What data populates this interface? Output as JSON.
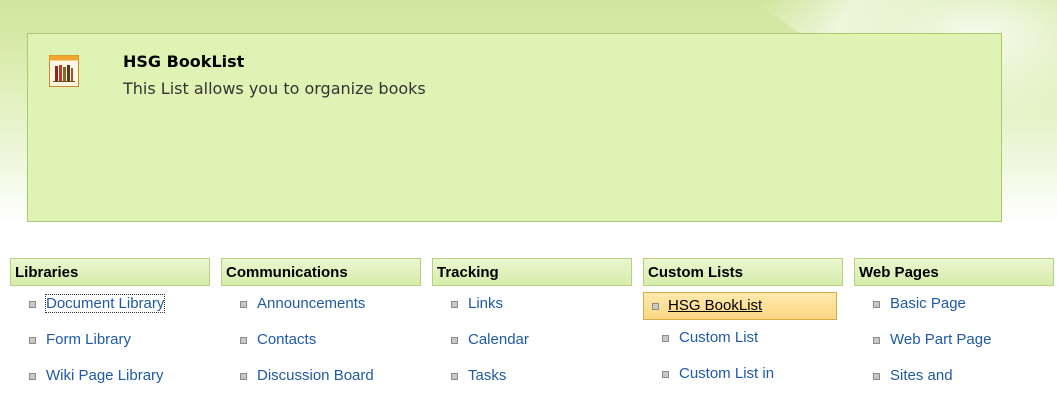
{
  "description": {
    "title": "HSG BookList",
    "text": "This List allows you to organize books",
    "icon": "books-list-icon"
  },
  "categories": [
    {
      "header": "Libraries",
      "items": [
        {
          "label": "Document Library"
        },
        {
          "label": "Form Library"
        },
        {
          "label": "Wiki Page Library"
        }
      ]
    },
    {
      "header": "Communications",
      "items": [
        {
          "label": "Announcements"
        },
        {
          "label": "Contacts"
        },
        {
          "label": "Discussion Board"
        }
      ]
    },
    {
      "header": "Tracking",
      "items": [
        {
          "label": "Links"
        },
        {
          "label": "Calendar"
        },
        {
          "label": "Tasks"
        }
      ]
    },
    {
      "header": "Custom Lists",
      "items": [
        {
          "label": "HSG BookList"
        },
        {
          "label": "Custom List"
        },
        {
          "label": "Custom List in"
        }
      ]
    },
    {
      "header": "Web Pages",
      "items": [
        {
          "label": "Basic Page"
        },
        {
          "label": "Web Part Page"
        },
        {
          "label": "Sites and"
        }
      ]
    }
  ],
  "selected_item": "HSG BookList",
  "focused_item": "Document Library",
  "colors": {
    "link": "#1f5aa6",
    "panel": "#dff4b4",
    "header": "#d6edab",
    "selected": "#fbd783"
  }
}
